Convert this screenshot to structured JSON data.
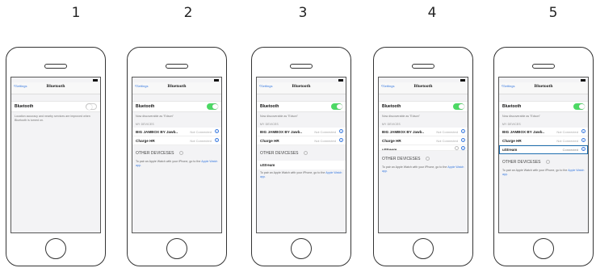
{
  "steps": [
    "1",
    "2",
    "3",
    "4",
    "5"
  ],
  "nav": {
    "back_label": "Settings",
    "title": "Bluetooth"
  },
  "bluetooth_label": "Bluetooth",
  "location_note": "Location accuracy and nearby services are improved when Bluetooth is turned on.",
  "discoverable_note": "Now discoverable as \"Edson\"",
  "my_devices_header": "MY DEVICES",
  "devices": [
    {
      "name": "BIG JAMBOX BY Jawb..",
      "status": "Not Connected"
    },
    {
      "name": "Charge HR",
      "status": "Not Connected"
    }
  ],
  "other_devices_label": "OTHER DEVICESES",
  "watch_note": {
    "prefix": "To pair an Apple Watch with your iPhone, go to the ",
    "link": "Apple Watch app."
  },
  "ustream": {
    "name": "uStream",
    "status": "Connected"
  },
  "colors": {
    "toggle_on": "#4cd964",
    "link_blue": "#3a7be0",
    "highlight": "#1f6fb0"
  }
}
